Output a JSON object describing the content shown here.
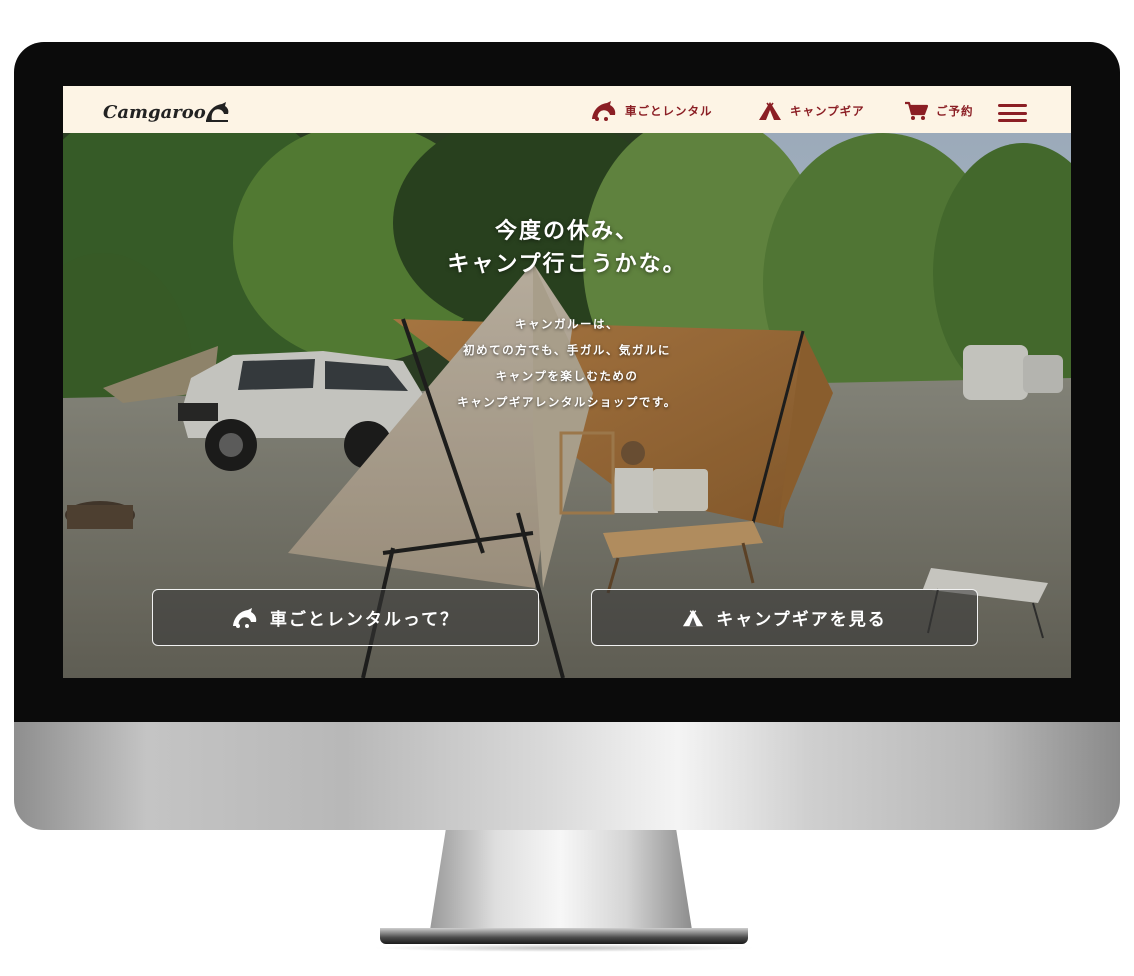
{
  "brand": {
    "logo_text": "Camgaroo"
  },
  "nav": {
    "items": [
      {
        "label": "車ごとレンタル",
        "icon": "kangaroo-car-icon"
      },
      {
        "label": "キャンプギア",
        "icon": "tent-icon"
      },
      {
        "label": "ご予約",
        "icon": "cart-icon"
      }
    ],
    "menu_icon": "hamburger-menu-icon"
  },
  "hero": {
    "headline_lines": [
      "今度の休み、",
      "キャンプ行こうかな。"
    ],
    "lead_lines": [
      "キャンガルーは、",
      "初めての方でも、手ガル、気ガルに",
      "キャンプを楽しむための",
      "キャンプギアレンタルショップです。"
    ]
  },
  "cta": {
    "rental_label": "車ごとレンタルって？",
    "gear_label": "キャンプギアを見る"
  },
  "colors": {
    "accent": "#8b1e24",
    "nav_bg": "#fdf4e5",
    "bezel": "#0b0b0b"
  }
}
